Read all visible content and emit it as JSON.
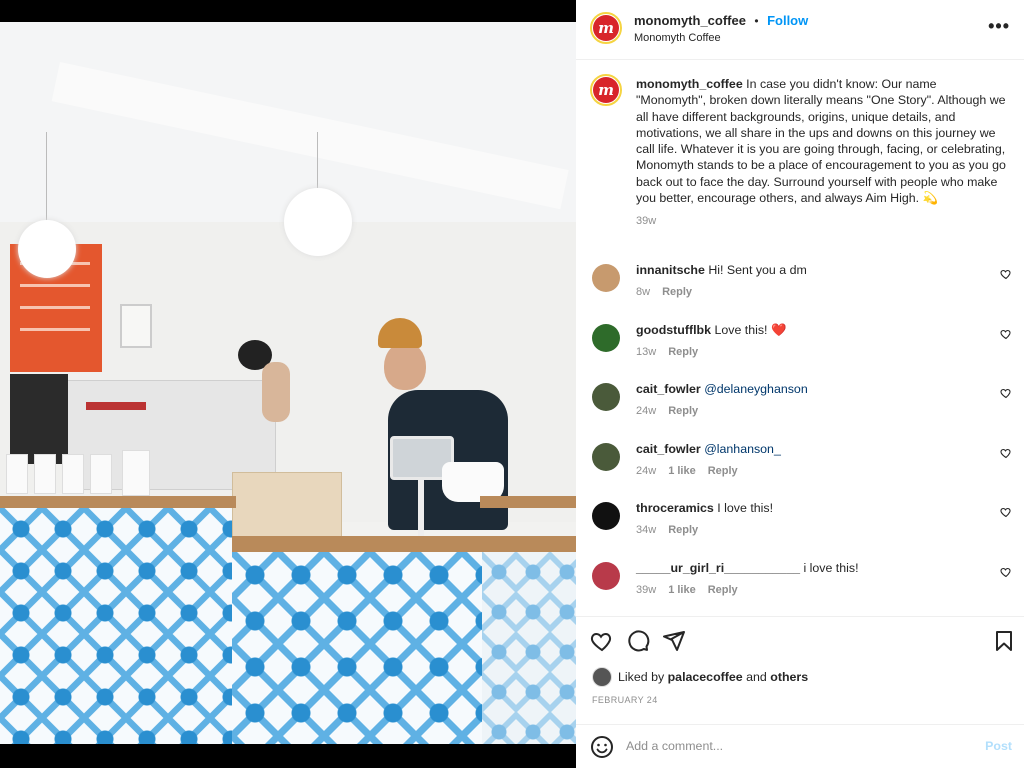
{
  "post": {
    "username": "monomyth_coffee",
    "follow_label": "Follow",
    "separator": "•",
    "location": "Monomyth Coffee",
    "more_label": "•••",
    "logo_letter": "m"
  },
  "caption": {
    "username": "monomyth_coffee",
    "text": "In case you didn't know: Our name \"Monomyth\", broken down literally means \"One Story\". Although we all have different backgrounds, origins, unique details, and motivations, we all share in the ups and downs on this journey we call life. Whatever it is you are going through, facing, or celebrating, Monomyth stands to be a place of encouragement to you as you go back out to face the day. Surround yourself with people who make you better, encourage others, and always Aim High. 💫",
    "age": "39w"
  },
  "comments": [
    {
      "user": "innanitsche",
      "text": "Hi! Sent you a dm",
      "age": "8w",
      "likes": "",
      "reply": "Reply",
      "avatar_color": "#c79a6e"
    },
    {
      "user": "goodstufflbk",
      "text": "Love this! ❤️",
      "age": "13w",
      "likes": "",
      "reply": "Reply",
      "avatar_color": "#2e6b2a"
    },
    {
      "user": "cait_fowler",
      "mention": "@delaneyghanson",
      "text": "",
      "age": "24w",
      "likes": "",
      "reply": "Reply",
      "avatar_color": "#4a5a3a"
    },
    {
      "user": "cait_fowler",
      "mention": "@lanhanson_",
      "text": "",
      "age": "24w",
      "likes": "1 like",
      "reply": "Reply",
      "avatar_color": "#4a5a3a"
    },
    {
      "user": "throceramics",
      "text": "I love this!",
      "age": "34w",
      "likes": "",
      "reply": "Reply",
      "avatar_color": "#111111"
    },
    {
      "user": "_____ur_girl_ri___________",
      "text": "i love this!",
      "age": "39w",
      "likes": "1 like",
      "reply": "Reply",
      "avatar_color": "#b83a4a"
    }
  ],
  "likes": {
    "prefix": "Liked by",
    "user": "palacecoffee",
    "middle": "and",
    "others": "others"
  },
  "date": "FEBRUARY 24",
  "add_comment": {
    "placeholder": "Add a comment...",
    "post_label": "Post"
  },
  "colors": {
    "accent": "#0095f6",
    "brand_red": "#d8252a",
    "tile_blue": "#2a8fd0"
  },
  "icons": [
    "heart-icon",
    "comment-icon",
    "share-icon",
    "bookmark-icon",
    "emoji-icon",
    "more-icon"
  ]
}
